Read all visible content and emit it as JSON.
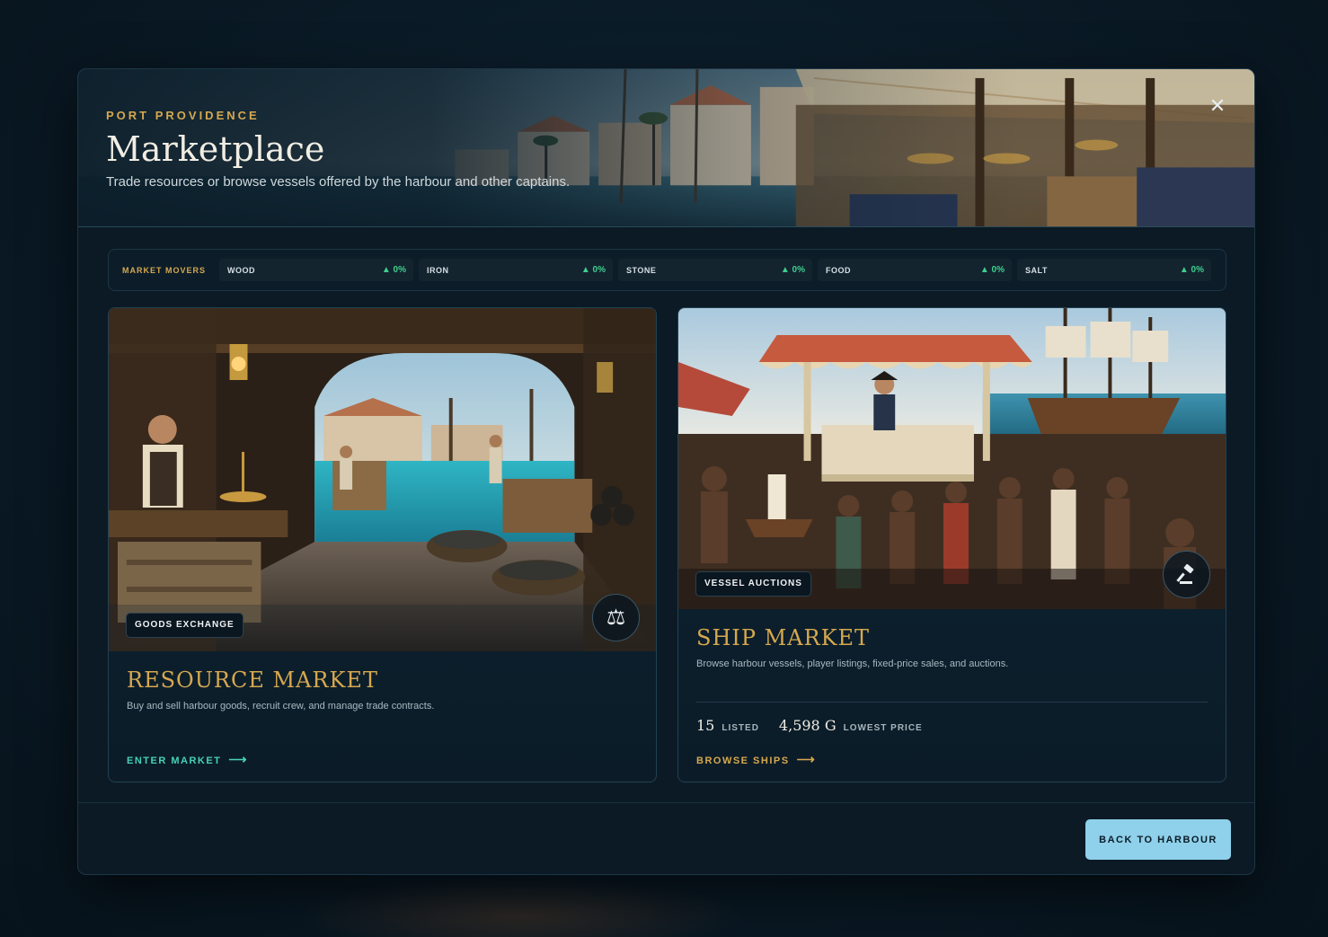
{
  "header": {
    "eyebrow": "PORT PROVIDENCE",
    "title": "Marketplace",
    "subtitle": "Trade resources or browse vessels offered by the harbour and other captains.",
    "close_icon": "close-icon"
  },
  "movers": {
    "label": "MARKET MOVERS",
    "items": [
      {
        "name": "WOOD",
        "change": "▲ 0%"
      },
      {
        "name": "IRON",
        "change": "▲ 0%"
      },
      {
        "name": "STONE",
        "change": "▲ 0%"
      },
      {
        "name": "FOOD",
        "change": "▲ 0%"
      },
      {
        "name": "SALT",
        "change": "▲ 0%"
      }
    ]
  },
  "resource_card": {
    "badge": "GOODS EXCHANGE",
    "icon": "scales-icon",
    "title": "RESOURCE MARKET",
    "description": "Buy and sell harbour goods, recruit crew, and manage trade contracts.",
    "cta": "ENTER MARKET",
    "arrow": "⟶"
  },
  "ship_card": {
    "badge": "VESSEL AUCTIONS",
    "icon": "gavel-icon",
    "title": "SHIP MARKET",
    "description": "Browse harbour vessels, player listings, fixed-price sales, and auctions.",
    "listed_count": "15",
    "listed_label": "LISTED",
    "lowest_price": "4,598 G",
    "lowest_price_label": "LOWEST PRICE",
    "cta": "BROWSE SHIPS",
    "arrow": "⟶"
  },
  "footer": {
    "back_label": "BACK TO HARBOUR"
  },
  "colors": {
    "accent_gold": "#d6a84f",
    "accent_green": "#3fcf8e",
    "cta_teal": "#47d1b8",
    "button_blue": "#8fd0ea",
    "panel_bg": "#0b1a25"
  }
}
